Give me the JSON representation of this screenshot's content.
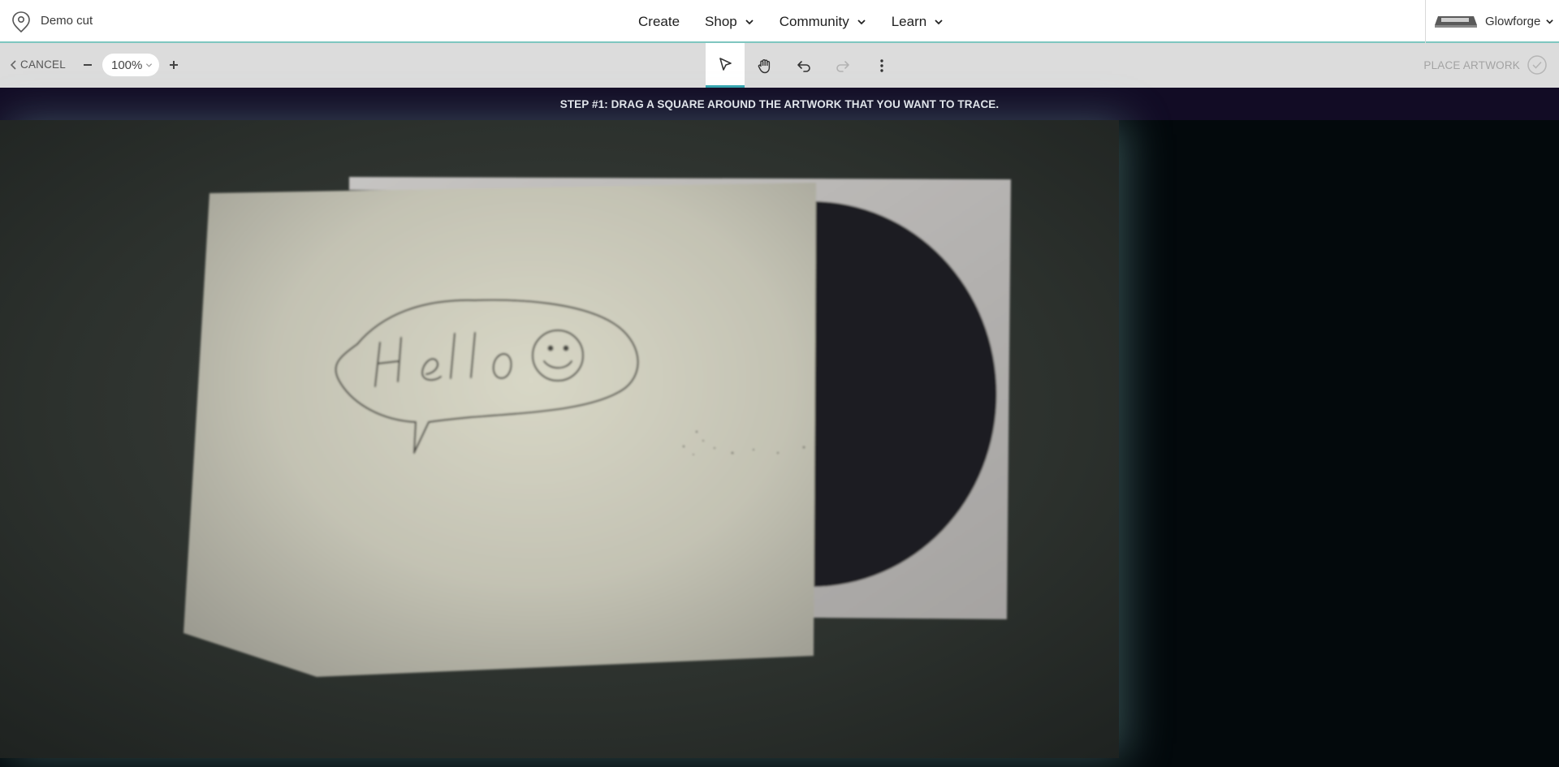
{
  "header": {
    "logo_icon": "glowforge-logo-icon",
    "project_title": "Demo cut",
    "nav": [
      {
        "label": "Create",
        "has_dropdown": false
      },
      {
        "label": "Shop",
        "has_dropdown": true
      },
      {
        "label": "Community",
        "has_dropdown": true
      },
      {
        "label": "Learn",
        "has_dropdown": true
      }
    ],
    "account": {
      "label": "Glowforge",
      "icon": "laser-machine-icon"
    }
  },
  "toolbar": {
    "cancel_label": "CANCEL",
    "zoom_value": "100%",
    "tools": [
      "select-pointer-icon",
      "hand-pan-icon",
      "undo-icon",
      "redo-icon",
      "more-vertical-icon"
    ],
    "active_tool": "select-pointer-icon",
    "redo_enabled": false,
    "place_artwork_label": "PLACE ARTWORK",
    "place_artwork_enabled": false
  },
  "banner": {
    "text": "STEP #1: DRAG A SQUARE AROUND THE ARTWORK THAT YOU WANT TO TRACE."
  },
  "colors": {
    "accent": "#36a6b0",
    "banner_bg": "#120c25",
    "toolbar_bg": "#dcdcdc",
    "workspace_bg": "#03090c"
  }
}
